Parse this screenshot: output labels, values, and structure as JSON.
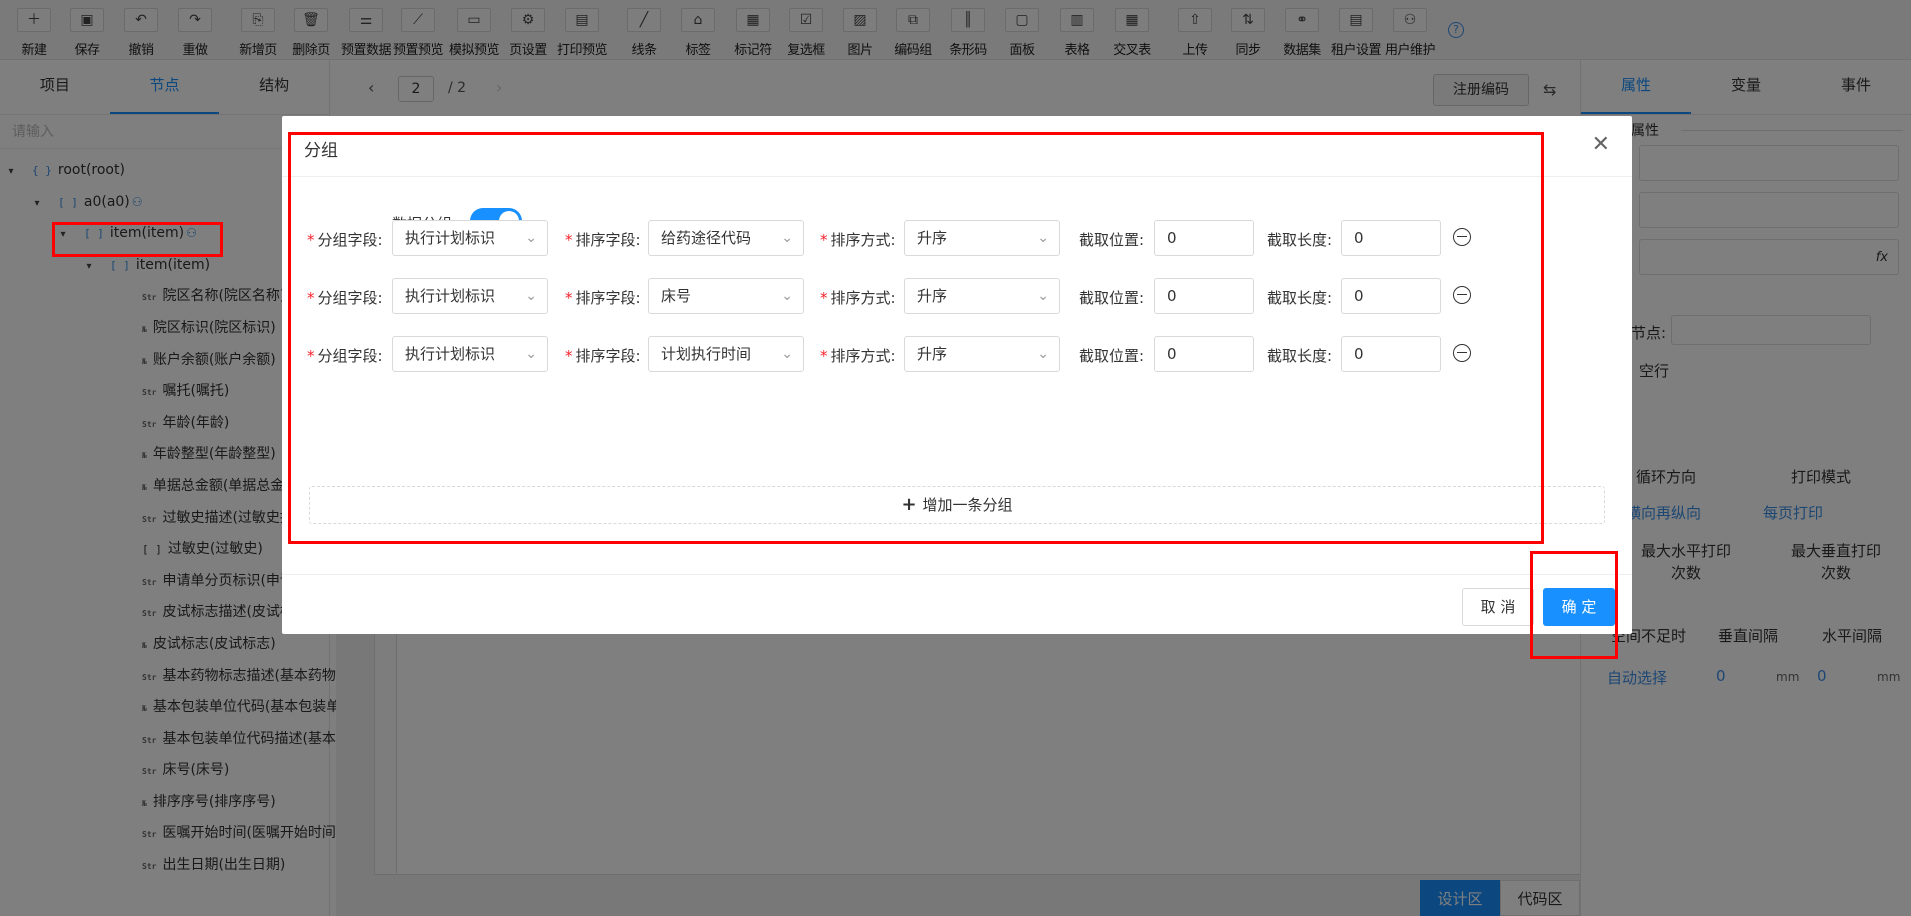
{
  "toolbar": [
    {
      "label": "新建",
      "icon": "file-plus-icon",
      "glyph": "＋"
    },
    {
      "label": "保存",
      "icon": "save-icon",
      "glyph": "▣"
    },
    {
      "label": "撤销",
      "icon": "undo-icon",
      "glyph": "↶"
    },
    {
      "label": "重做",
      "icon": "redo-icon",
      "glyph": "↷"
    },
    {
      "label": "新增页",
      "icon": "add-page-icon",
      "glyph": "⎘"
    },
    {
      "label": "删除页",
      "icon": "trash-icon",
      "glyph": "🗑"
    },
    {
      "label": "预置数据",
      "icon": "preset-data-icon",
      "glyph": "⚌"
    },
    {
      "label": "预置预览",
      "icon": "chart-preview-icon",
      "glyph": "⟋"
    },
    {
      "label": "模拟预览",
      "icon": "simulate-icon",
      "glyph": "▭"
    },
    {
      "label": "页设置",
      "icon": "gear-icon",
      "glyph": "⚙"
    },
    {
      "label": "打印预览",
      "icon": "print-preview-icon",
      "glyph": "▤"
    },
    {
      "label": "线条",
      "icon": "line-icon",
      "glyph": "╱"
    },
    {
      "label": "标签",
      "icon": "tag-icon",
      "glyph": "⌂"
    },
    {
      "label": "标记符",
      "icon": "marker-icon",
      "glyph": "▦"
    },
    {
      "label": "复选框",
      "icon": "checkbox-icon",
      "glyph": "☑"
    },
    {
      "label": "图片",
      "icon": "image-icon",
      "glyph": "▨"
    },
    {
      "label": "编码组",
      "icon": "code-group-icon",
      "glyph": "⧉"
    },
    {
      "label": "条形码",
      "icon": "barcode-icon",
      "glyph": "║"
    },
    {
      "label": "面板",
      "icon": "panel-icon",
      "glyph": "▢"
    },
    {
      "label": "表格",
      "icon": "table-icon",
      "glyph": "▥"
    },
    {
      "label": "交叉表",
      "icon": "crosstab-icon",
      "glyph": "▦"
    },
    {
      "label": "上传",
      "icon": "upload-icon",
      "glyph": "⇧"
    },
    {
      "label": "同步",
      "icon": "sync-icon",
      "glyph": "⇅"
    },
    {
      "label": "数据集",
      "icon": "dataset-icon",
      "glyph": "⚭"
    },
    {
      "label": "租户设置",
      "icon": "tenant-settings-icon",
      "glyph": "▤"
    },
    {
      "label": "用户维护",
      "icon": "user-maintain-icon",
      "glyph": "⚇"
    }
  ],
  "left_panel": {
    "tabs": [
      "项目",
      "节点",
      "结构"
    ],
    "active_tab": 1,
    "search_placeholder": "请输入",
    "tree": [
      {
        "label": "root(root)",
        "level": 0,
        "arrow": "▾",
        "kind": "obj",
        "user": false
      },
      {
        "label": "a0(a0)",
        "level": 1,
        "arrow": "▾",
        "kind": "arr",
        "user": true
      },
      {
        "label": "item(item)",
        "level": 2,
        "arrow": "▾",
        "kind": "arr",
        "user": true
      },
      {
        "label": "item(item)",
        "level": 3,
        "arrow": "▾",
        "kind": "arr",
        "user": false
      },
      {
        "label": "院区名称(院区名称)",
        "level": 4,
        "arrow": "",
        "kind": "Str",
        "user": false
      },
      {
        "label": "院区标识(院区标识)",
        "level": 4,
        "arrow": "",
        "kind": "No",
        "user": false
      },
      {
        "label": "账户余额(账户余额)",
        "level": 4,
        "arrow": "",
        "kind": "No",
        "user": false
      },
      {
        "label": "嘱托(嘱托)",
        "level": 4,
        "arrow": "",
        "kind": "Str",
        "user": false
      },
      {
        "label": "年龄(年龄)",
        "level": 4,
        "arrow": "",
        "kind": "Str",
        "user": false
      },
      {
        "label": "年龄整型(年龄整型)",
        "level": 4,
        "arrow": "",
        "kind": "No",
        "user": false
      },
      {
        "label": "单据总金额(单据总金额)",
        "level": 4,
        "arrow": "",
        "kind": "No",
        "user": false
      },
      {
        "label": "过敏史描述(过敏史描述)",
        "level": 4,
        "arrow": "",
        "kind": "Str",
        "user": false
      },
      {
        "label": "过敏史(过敏史)",
        "level": 4,
        "arrow": "",
        "kind": "arr",
        "user": false
      },
      {
        "label": "申请单分页标识(申请单分页标识)",
        "level": 4,
        "arrow": "",
        "kind": "Str",
        "user": false
      },
      {
        "label": "皮试标志描述(皮试标志描述)",
        "level": 4,
        "arrow": "",
        "kind": "Str",
        "user": false
      },
      {
        "label": "皮试标志(皮试标志)",
        "level": 4,
        "arrow": "",
        "kind": "No",
        "user": false
      },
      {
        "label": "基本药物标志描述(基本药物标志描述)",
        "level": 4,
        "arrow": "",
        "kind": "Str",
        "user": false
      },
      {
        "label": "基本包装单位代码(基本包装单位代码)",
        "level": 4,
        "arrow": "",
        "kind": "No",
        "user": false
      },
      {
        "label": "基本包装单位代码描述(基本包装单位代码描述)",
        "level": 4,
        "arrow": "",
        "kind": "Str",
        "user": false
      },
      {
        "label": "床号(床号)",
        "level": 4,
        "arrow": "",
        "kind": "Str",
        "user": false
      },
      {
        "label": "排序序号(排序序号)",
        "level": 4,
        "arrow": "",
        "kind": "No",
        "user": false
      },
      {
        "label": "医嘱开始时间(医嘱开始时间)",
        "level": 4,
        "arrow": "",
        "kind": "Str",
        "user": false
      },
      {
        "label": "出生日期(出生日期)",
        "level": 4,
        "arrow": "",
        "kind": "Str",
        "user": false
      }
    ]
  },
  "center": {
    "page_current": "2",
    "page_total": "/ 2",
    "register_code_label": "注册编码",
    "bottom_tabs": [
      "设计区",
      "代码区"
    ],
    "active_bottom_tab": 0
  },
  "right_panel": {
    "tabs": [
      "属性",
      "变量",
      "事件"
    ],
    "active_tab": 0,
    "section_title": "属性",
    "fx_label": "fx",
    "node_label": "节点:",
    "empty_row_label": "空行",
    "loop_direction_label": "循环方向",
    "print_mode_label": "打印模式",
    "loop_direction_value": "横向再纵向",
    "print_mode_value": "每页打印",
    "max_horizontal_label": "最大水平打印次数",
    "max_vertical_label": "最大垂直打印次数",
    "space_short_label": "空间不足时",
    "vertical_gap_label": "垂直间隔",
    "horizontal_gap_label": "水平间隔",
    "auto_select_value": "自动选择",
    "vertical_gap_value": "0",
    "horizontal_gap_value": "0",
    "unit": "mm"
  },
  "dialog": {
    "title": "分组",
    "data_group_label": "数据分组:",
    "data_group_enabled": true,
    "group_field_label": "分组字段:",
    "sort_field_label": "排序字段:",
    "sort_order_label": "排序方式:",
    "cut_pos_label": "截取位置:",
    "cut_len_label": "截取长度:",
    "rows": [
      {
        "group_field": "执行计划标识",
        "sort_field": "给药途径代码",
        "sort_order": "升序",
        "cut_pos": "0",
        "cut_len": "0"
      },
      {
        "group_field": "执行计划标识",
        "sort_field": "床号",
        "sort_order": "升序",
        "cut_pos": "0",
        "cut_len": "0"
      },
      {
        "group_field": "执行计划标识",
        "sort_field": "计划执行时间",
        "sort_order": "升序",
        "cut_pos": "0",
        "cut_len": "0"
      }
    ],
    "add_group_label": "增加一条分组",
    "cancel_label": "取 消",
    "ok_label": "确 定"
  },
  "colors": {
    "accent": "#1890ff",
    "highlight": "#ff0000",
    "required": "#f5222d"
  }
}
